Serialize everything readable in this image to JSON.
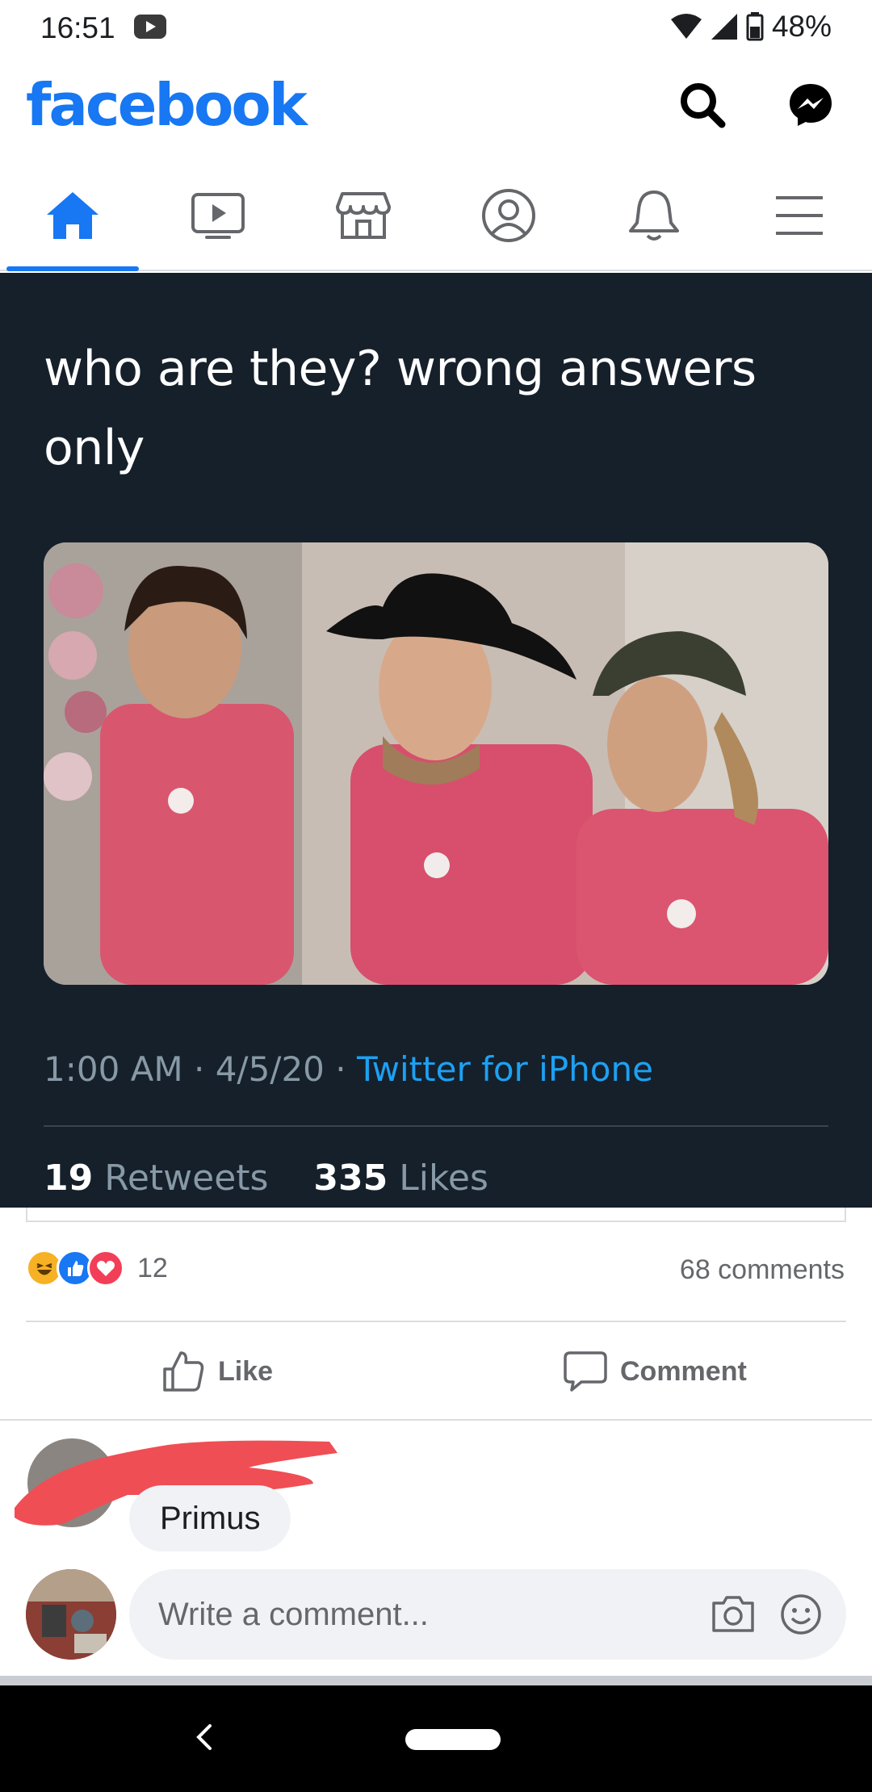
{
  "status_bar": {
    "time": "16:51",
    "battery": "48%"
  },
  "header": {
    "brand": "facebook"
  },
  "tabs": [
    {
      "icon": "home-icon",
      "active": true
    },
    {
      "icon": "watch-icon",
      "active": false
    },
    {
      "icon": "marketplace-icon",
      "active": false
    },
    {
      "icon": "profile-icon",
      "active": false
    },
    {
      "icon": "notifications-icon",
      "active": false
    },
    {
      "icon": "menu-icon",
      "active": false
    }
  ],
  "tweet": {
    "text_line1": "who are they? wrong answers",
    "text_line2": "only",
    "time": "1:00 AM",
    "date": "4/5/20",
    "source": "Twitter for iPhone",
    "retweets_count": "19",
    "retweets_label": "Retweets",
    "likes_count": "335",
    "likes_label": "Likes"
  },
  "reactions": {
    "count": "12",
    "comments": "68 comments"
  },
  "actions": {
    "like": "Like",
    "comment": "Comment"
  },
  "comment": {
    "text": "Primus"
  },
  "composer": {
    "placeholder": "Write a comment..."
  },
  "colors": {
    "brand": "#1877f2",
    "tweet_bg": "#15202b",
    "twitter_blue": "#1da1f2"
  }
}
